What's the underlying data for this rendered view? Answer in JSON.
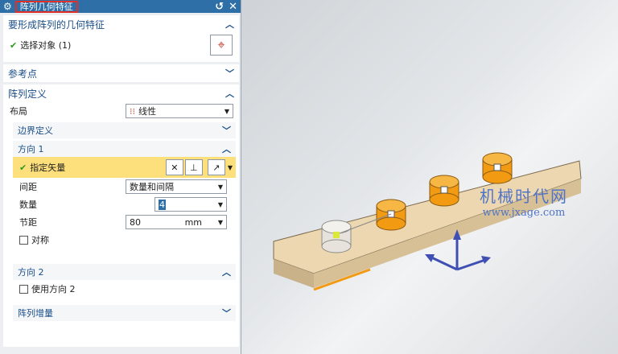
{
  "dialog": {
    "title": "阵列几何特征",
    "reset_icon": "↺",
    "close_icon": "✕"
  },
  "sec_geom": {
    "title": "要形成阵列的几何特征",
    "select_label": "选择对象 (1)"
  },
  "sec_ref": {
    "title": "参考点"
  },
  "sec_def": {
    "title": "阵列定义",
    "layout_label": "布局",
    "layout_value": "线性"
  },
  "boundary": {
    "title": "边界定义"
  },
  "dir1": {
    "title": "方向 1",
    "vector_label": "指定矢量",
    "spacing_label": "间距",
    "spacing_value": "数量和间隔",
    "count_label": "数量",
    "count_value": "4",
    "pitch_label": "节距",
    "pitch_value": "80",
    "pitch_unit": "mm",
    "sym_label": "对称"
  },
  "dir2": {
    "title": "方向 2",
    "use_label": "使用方向 2"
  },
  "increment": {
    "title": "阵列增量"
  },
  "watermark": {
    "line1": "机械时代网",
    "line2": "www.jxage.com"
  },
  "colors": {
    "title_bar": "#2f6fa8",
    "highlight": "#fde07b",
    "accent": "#1b4f8a",
    "cylinder": "#f29a12",
    "plate": "#ecd7b0"
  }
}
